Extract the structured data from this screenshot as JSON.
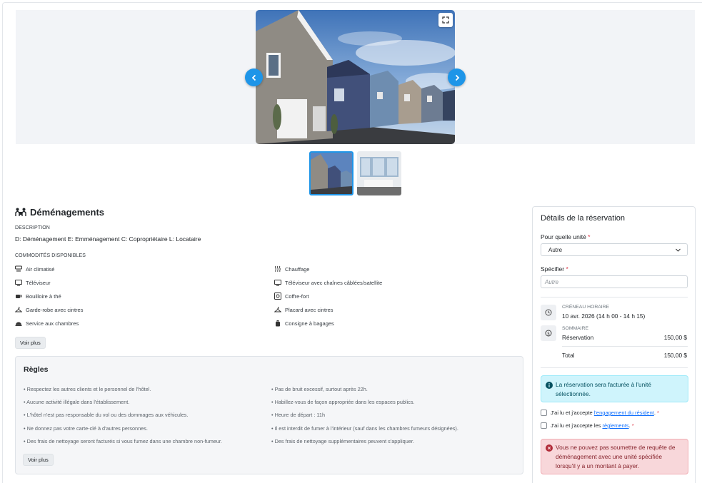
{
  "gallery": {
    "expand_icon": "expand-icon",
    "prev_icon": "chevron-left-icon",
    "next_icon": "chevron-right-icon",
    "accent_color": "#1e95e8",
    "thumbnails": [
      "exterior-townhouses",
      "interior-living-room"
    ]
  },
  "amenity_page": {
    "title": "Déménagements",
    "title_icon": "people-moving-icon",
    "description_label": "DESCRIPTION",
    "description": "D: Déménagement E: Emménagement C: Copropriétaire L: Locataire",
    "amenities_label": "COMMODITÉS DISPONIBLES",
    "amenities": [
      {
        "label": "Air climatisé",
        "icon": "air-conditioner-icon"
      },
      {
        "label": "Chauffage",
        "icon": "heat-icon"
      },
      {
        "label": "Téléviseur",
        "icon": "tv-icon"
      },
      {
        "label": "Téléviseur avec chaînes câblées/satellite",
        "icon": "tv-icon"
      },
      {
        "label": "Bouilloire à thé",
        "icon": "kettle-icon"
      },
      {
        "label": "Coffre-fort",
        "icon": "safe-icon"
      },
      {
        "label": "Garde-robe avec cintres",
        "icon": "hanger-icon"
      },
      {
        "label": "Placard avec cintres",
        "icon": "hanger-icon"
      },
      {
        "label": "Service aux chambres",
        "icon": "room-service-icon"
      },
      {
        "label": "Consigne à bagages",
        "icon": "luggage-icon"
      }
    ],
    "see_more_label": "Voir plus"
  },
  "rules": {
    "title": "Règles",
    "left": [
      "• Respectez les autres clients et le personnel de l'hôtel.",
      "• Aucune activité illégale dans l'établissement.",
      "• L'hôtel n'est pas responsable du vol ou des dommages aux véhicules.",
      "• Ne donnez pas votre carte-clé à d'autres personnes.",
      "• Des frais de nettoyage seront facturés si vous fumez dans une chambre non-fumeur."
    ],
    "right": [
      "• Pas de bruit excessif, surtout après 22h.",
      "• Habillez-vous de façon appropriée dans les espaces publics.",
      "• Heure de départ : 11h",
      "• Il est interdit de fumer à l'intérieur (sauf dans les chambres fumeurs désignées).",
      "• Des frais de nettoyage supplémentaires peuvent s'appliquer."
    ],
    "see_more_label": "Voir plus"
  },
  "reservation": {
    "title": "Détails de la réservation",
    "unit_label": "Pour quelle unité",
    "unit_value": "Autre",
    "specify_label": "Spécifier",
    "specify_placeholder": "Autre",
    "required_mark": "*",
    "slot_caption": "CRÉNEAU HORAIRE",
    "slot_value": "10 avr. 2026 (14 h 00 - 14 h 15)",
    "summary_caption": "SOMMAIRE",
    "summary_item": "Réservation",
    "summary_item_amount": "150,00 $",
    "total_label": "Total",
    "total_amount": "150,00 $",
    "info_alert": "La réservation sera facturée à l'unité sélectionnée.",
    "check1_prefix": "J'ai lu et j'accepte ",
    "check1_link": "l'engagement du résident",
    "check1_suffix": ".",
    "check2_prefix": "J'ai lu et j'accepte les ",
    "check2_link": "règlements",
    "check2_suffix": ".",
    "error_alert": "Vous ne pouvez pas soumettre de requête de déménagement avec une unité spécifiée lorsqu'il y a un montant à payer.",
    "info_color": "#cff4fc",
    "danger_color": "#f8d7da"
  }
}
